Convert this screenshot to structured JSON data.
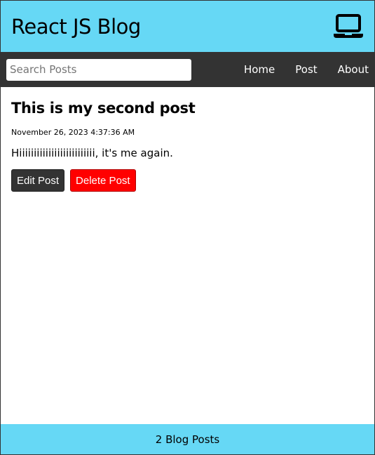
{
  "header": {
    "title": "React JS Blog",
    "icon": "laptop-icon"
  },
  "nav": {
    "search": {
      "placeholder": "Search Posts",
      "value": ""
    },
    "links": [
      {
        "label": "Home"
      },
      {
        "label": "Post"
      },
      {
        "label": "About"
      }
    ]
  },
  "post": {
    "title": "This is my second post",
    "datetime": "November 26, 2023 4:37:36 AM",
    "body": "Hiiiiiiiiiiiiiiiiiiiiiiiiii, it's me again.",
    "edit_label": "Edit Post",
    "delete_label": "Delete Post"
  },
  "footer": {
    "text": "2 Blog Posts"
  },
  "colors": {
    "header_bg": "#66d8f5",
    "nav_bg": "#333333",
    "delete_button": "#ff0000",
    "edit_button": "#333333"
  }
}
